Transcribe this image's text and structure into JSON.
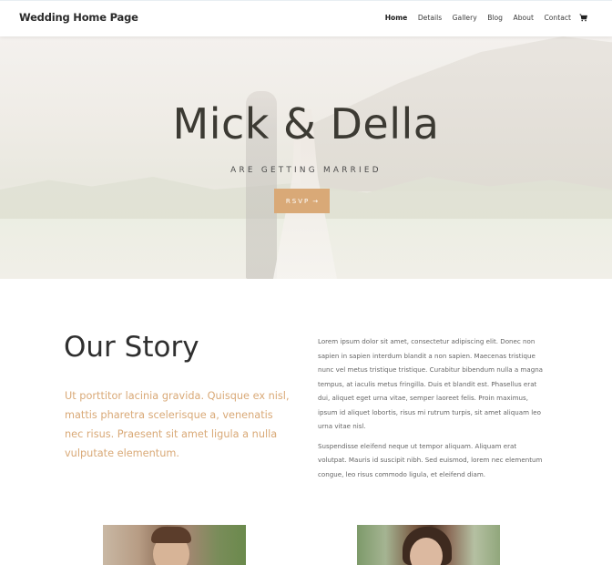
{
  "header": {
    "logo": "Wedding Home Page",
    "nav": [
      {
        "label": "Home",
        "active": true
      },
      {
        "label": "Details",
        "active": false
      },
      {
        "label": "Gallery",
        "active": false
      },
      {
        "label": "Blog",
        "active": false
      },
      {
        "label": "About",
        "active": false
      },
      {
        "label": "Contact",
        "active": false
      }
    ],
    "cart_icon": "cart-icon"
  },
  "hero": {
    "title": "Mick & Della",
    "subtitle": "ARE GETTING MARRIED",
    "button_label": "RSVP",
    "button_arrow": "→"
  },
  "story": {
    "title": "Our Story",
    "lead": "Ut porttitor lacinia gravida. Quisque ex nisl, mattis pharetra scelerisque a, venenatis nec risus. Praesent sit amet ligula a nulla vulputate elementum.",
    "paragraph_1": "Lorem ipsum dolor sit amet, consectetur adipiscing elit. Donec non sapien in sapien interdum blandit a non sapien. Maecenas tristique nunc vel metus tristique tristique. Curabitur bibendum nulla a magna tempus, at iaculis metus fringilla. Duis et blandit est. Phasellus erat dui, aliquet eget urna vitae, semper laoreet felis. Proin maximus, ipsum id aliquet lobortis, risus mi rutrum turpis, sit amet aliquam leo urna vitae nisl.",
    "paragraph_2": "Suspendisse eleifend neque ut tempor aliquam. Aliquam erat volutpat. Mauris id suscipit nibh. Sed euismod, lorem nec elementum congue, leo risus commodo ligula, et eleifend diam."
  },
  "colors": {
    "accent": "#d9a977",
    "title": "#3c3a33"
  }
}
